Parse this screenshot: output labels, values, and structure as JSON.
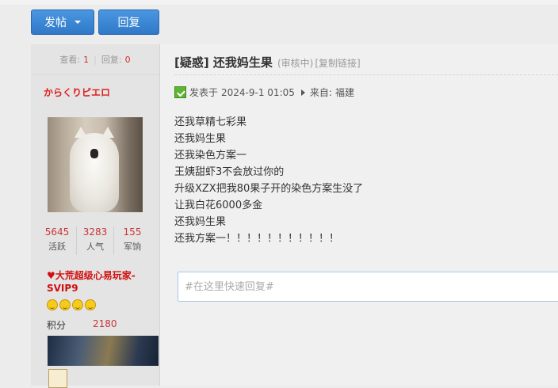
{
  "toolbar": {
    "post_label": "发帖",
    "reply_label": "回复"
  },
  "sidebar": {
    "views_label": "查看:",
    "views": "1",
    "replies_label": "回复:",
    "replies": "0",
    "username": "からくりピエロ",
    "stats": [
      {
        "value": "5645",
        "label": "活跃"
      },
      {
        "value": "3283",
        "label": "人气"
      },
      {
        "value": "155",
        "label": "军饷"
      }
    ],
    "vip_title": "♥大荒超级心易玩家-SVIP9",
    "score_label": "积分",
    "score": "2180"
  },
  "post": {
    "title": "[疑惑] 还我妈生果",
    "status_note": "(审核中)",
    "copy_link": "[复制链接]",
    "posted_label": "发表于",
    "posted_time": "2024-9-1 01:05",
    "from_label": "来自:",
    "from_value": "福建",
    "lines": [
      "还我草精七彩果",
      "还我妈生果",
      "还我染色方案一",
      "王姨甜虾3不会放过你的",
      "升级XZX把我80果子开的染色方案生没了",
      "让我白花6000多金",
      "还我妈生果",
      "还我方案一！！！！！！！！！！！"
    ]
  },
  "reply": {
    "placeholder": "#在这里快速回复#"
  }
}
